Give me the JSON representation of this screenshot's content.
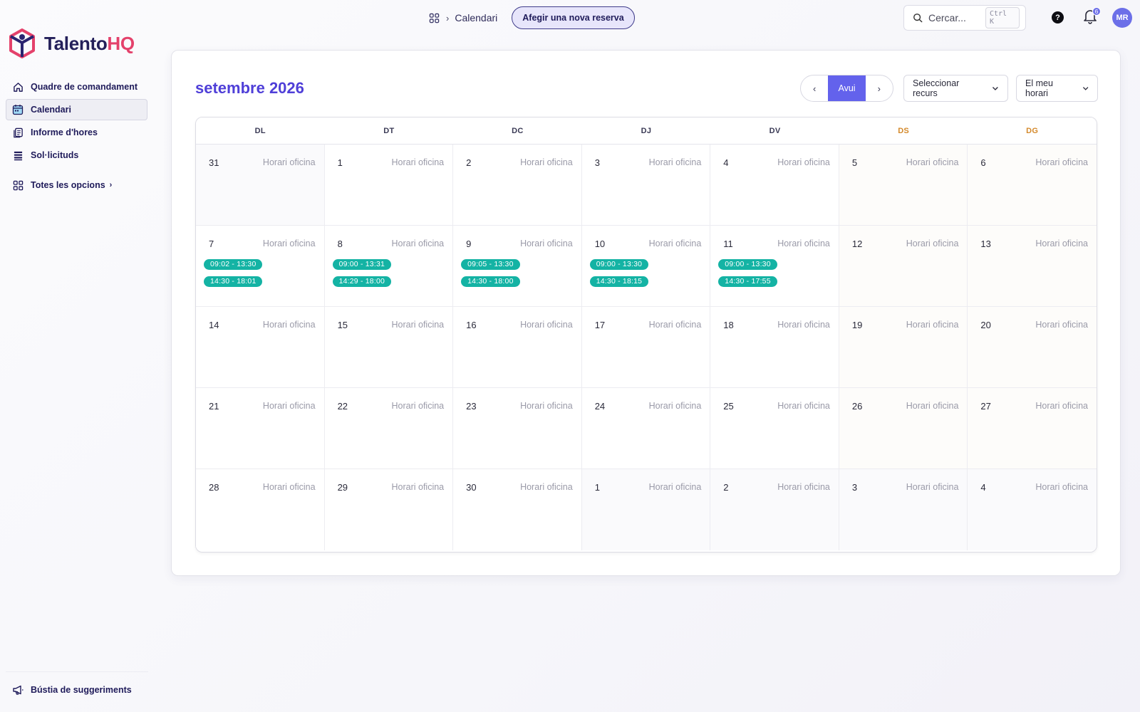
{
  "brand": {
    "name_part1": "Talento",
    "name_part2": "HQ",
    "primary": "#24205a",
    "accent": "#e4416b"
  },
  "sidebar": {
    "items": [
      {
        "label": "Quadre de comandament",
        "icon": "home-icon",
        "active": false
      },
      {
        "label": "Calendari",
        "icon": "calendar-icon",
        "active": true
      },
      {
        "label": "Informe d'hores",
        "icon": "report-icon",
        "active": false
      },
      {
        "label": "Sol·licituds",
        "icon": "list-icon",
        "active": false
      }
    ],
    "more_label": "Totes les opcions",
    "footer_label": "Bústia de suggeriments"
  },
  "topbar": {
    "breadcrumb_current": "Calendari",
    "new_booking_label": "Afegir una nova reserva",
    "search_placeholder": "Cercar...",
    "search_shortcut": "Ctrl K",
    "help_glyph": "?",
    "notification_count": "6",
    "avatar_initials": "MR"
  },
  "calendar": {
    "month_title": "setembre 2026",
    "today_label": "Avui",
    "resource_select": "Seleccionar recurs",
    "schedule_select": "El meu horari",
    "cell_label": "Horari oficina",
    "weekdays": [
      "DL",
      "DT",
      "DC",
      "DJ",
      "DV",
      "DS",
      "DG"
    ],
    "accent_color": "#6362ec",
    "event_color": "#14b3a4",
    "weekend_color": "#d4892b",
    "weeks": [
      [
        {
          "day": "31",
          "outside": true,
          "events": []
        },
        {
          "day": "1",
          "events": []
        },
        {
          "day": "2",
          "events": []
        },
        {
          "day": "3",
          "events": []
        },
        {
          "day": "4",
          "events": []
        },
        {
          "day": "5",
          "events": []
        },
        {
          "day": "6",
          "events": []
        }
      ],
      [
        {
          "day": "7",
          "events": [
            "09:02 - 13:30",
            "14:30 - 18:01"
          ]
        },
        {
          "day": "8",
          "events": [
            "09:00 - 13:31",
            "14:29 - 18:00"
          ]
        },
        {
          "day": "9",
          "events": [
            "09:05 - 13:30",
            "14:30 - 18:00"
          ]
        },
        {
          "day": "10",
          "events": [
            "09:00 - 13:30",
            "14:30 - 18:15"
          ]
        },
        {
          "day": "11",
          "events": [
            "09:00 - 13:30",
            "14:30 - 17:55"
          ]
        },
        {
          "day": "12",
          "events": []
        },
        {
          "day": "13",
          "events": []
        }
      ],
      [
        {
          "day": "14",
          "events": []
        },
        {
          "day": "15",
          "events": []
        },
        {
          "day": "16",
          "events": []
        },
        {
          "day": "17",
          "events": []
        },
        {
          "day": "18",
          "events": []
        },
        {
          "day": "19",
          "events": []
        },
        {
          "day": "20",
          "events": []
        }
      ],
      [
        {
          "day": "21",
          "events": []
        },
        {
          "day": "22",
          "events": []
        },
        {
          "day": "23",
          "events": []
        },
        {
          "day": "24",
          "events": []
        },
        {
          "day": "25",
          "events": []
        },
        {
          "day": "26",
          "events": []
        },
        {
          "day": "27",
          "events": []
        }
      ],
      [
        {
          "day": "28",
          "events": []
        },
        {
          "day": "29",
          "events": []
        },
        {
          "day": "30",
          "events": []
        },
        {
          "day": "1",
          "outside": true,
          "events": []
        },
        {
          "day": "2",
          "outside": true,
          "events": []
        },
        {
          "day": "3",
          "outside": true,
          "events": []
        },
        {
          "day": "4",
          "outside": true,
          "events": []
        }
      ]
    ]
  }
}
